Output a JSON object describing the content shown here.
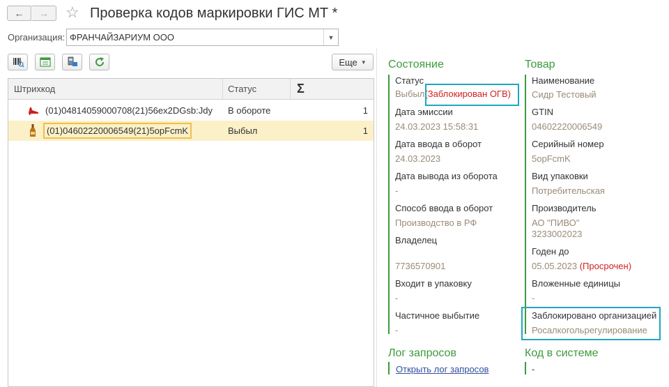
{
  "window": {
    "title": "Проверка кодов маркировки ГИС МТ *"
  },
  "organization": {
    "label": "Организация:",
    "value": "ФРАНЧАЙЗАРИУМ ООО"
  },
  "toolbar": {
    "more_label": "Еще"
  },
  "table": {
    "columns": {
      "barcode": "Штрихкод",
      "status": "Статус",
      "sum": "Σ"
    },
    "rows": [
      {
        "icon": "shoe-icon",
        "code": "(01)04814059000708(21)56ex2DGsb:Jdy",
        "status": "В обороте",
        "count": "1"
      },
      {
        "icon": "bottle-icon",
        "code": "(01)04602220006549(21)5opFcmK",
        "status": "Выбыл",
        "count": "1"
      }
    ]
  },
  "state": {
    "title": "Состояние",
    "status_label": "Статус",
    "status_value": "Выбыл",
    "status_extra": "(Заблокирован ОГВ)",
    "emission_label": "Дата эмиссии",
    "emission_value": "24.03.2023 15:58:31",
    "input_date_label": "Дата ввода в оборот",
    "input_date_value": "24.03.2023",
    "output_date_label": "Дата вывода из оборота",
    "output_date_value": "-",
    "input_method_label": "Способ ввода в оборот",
    "input_method_value": "Производство в РФ",
    "owner_label": "Владелец",
    "owner_value": "7736570901",
    "package_label": "Входит в упаковку",
    "package_value": "-",
    "partial_label": "Частичное выбытие",
    "partial_value": "-"
  },
  "product": {
    "title": "Товар",
    "name_label": "Наименование",
    "name_value": "Сидр Тестовый",
    "gtin_label": "GTIN",
    "gtin_value": "04602220006549",
    "serial_label": "Серийный номер",
    "serial_value": "5opFcmK",
    "pack_type_label": "Вид упаковки",
    "pack_type_value": "Потребительская",
    "producer_label": "Производитель",
    "producer_name": "АО \"ПИВО\"",
    "producer_inn": "3233002023",
    "expiry_label": "Годен до",
    "expiry_value": "05.05.2023",
    "expiry_extra": "(Просрочен)",
    "nested_label": "Вложенные единицы",
    "nested_value": "-",
    "blocked_label": "Заблокировано организацией",
    "blocked_value": "Росалкогольрегулирование"
  },
  "log": {
    "title": "Лог запросов",
    "link": "Открыть лог запросов"
  },
  "system_code": {
    "title": "Код в системе",
    "value": "-"
  },
  "colors": {
    "accent_green": "#3d9a3d",
    "value_muted": "#9a8a78",
    "alert_red": "#d42020",
    "highlight_cyan": "#1ea7bd",
    "selection": "#fbf0c8"
  }
}
